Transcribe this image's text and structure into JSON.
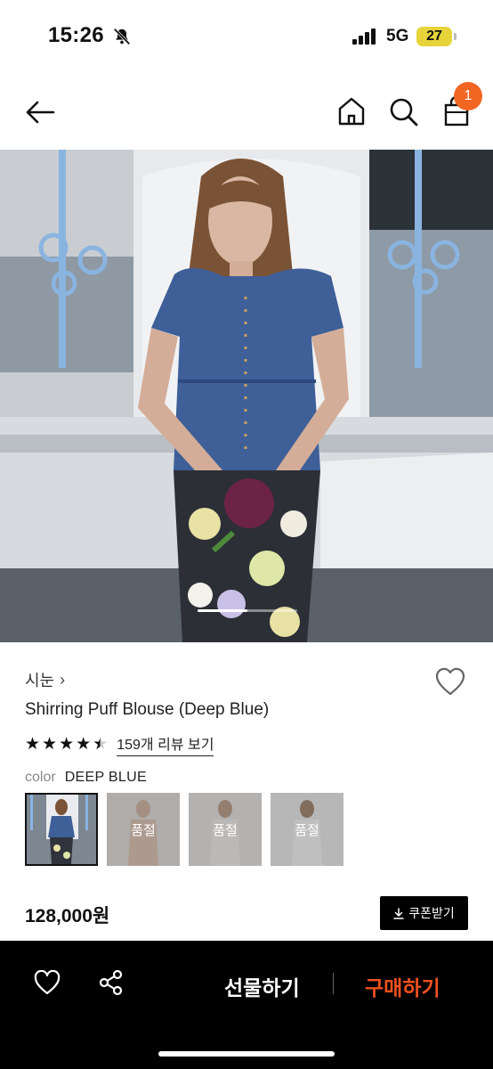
{
  "status_bar": {
    "time": "15:26",
    "network": "5G",
    "battery": "27"
  },
  "nav": {
    "cart_count": "1"
  },
  "product": {
    "brand": "시눈",
    "brand_chevron": "›",
    "title": "Shirring Puff Blouse (Deep Blue)",
    "rating_stars": 4.5,
    "review_link": "159개 리뷰 보기",
    "color_label": "color",
    "color_value": "DEEP BLUE",
    "swatches": [
      {
        "state": "selected"
      },
      {
        "label": "품절"
      },
      {
        "label": "품절"
      },
      {
        "label": "품절"
      }
    ],
    "price": "128,000원",
    "coupon_label": "쿠폰받기"
  },
  "bottom_bar": {
    "gift_label": "선물하기",
    "buy_label": "구매하기"
  },
  "colors": {
    "badge": "#f26522",
    "buy": "#f0511e",
    "bar": "#000000"
  },
  "icons": [
    "bell-off-icon",
    "signal-icon",
    "back-arrow-icon",
    "home-icon",
    "search-icon",
    "shopping-bag-icon",
    "heart-icon",
    "star-icon",
    "download-icon",
    "share-icon"
  ]
}
